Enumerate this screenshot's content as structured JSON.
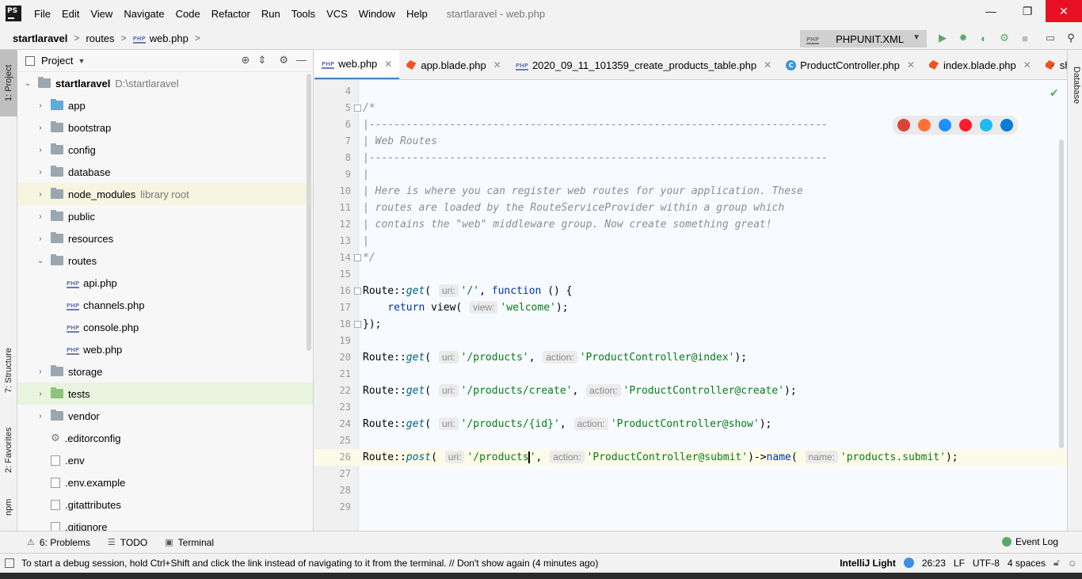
{
  "window": {
    "title": "startlaravel - web.php",
    "menu": [
      "File",
      "Edit",
      "View",
      "Navigate",
      "Code",
      "Refactor",
      "Run",
      "Tools",
      "VCS",
      "Window",
      "Help"
    ],
    "controls": {
      "minimize": "—",
      "maximize": "❐",
      "close": "✕"
    }
  },
  "breadcrumb": [
    "startlaravel",
    "routes",
    "web.php"
  ],
  "run_config": "PHPUNIT.XML",
  "left_tabs": [
    "1: Project",
    "7: Structure",
    "2: Favorites",
    "npm"
  ],
  "right_tabs": [
    "Database"
  ],
  "project": {
    "title": "Project",
    "root": {
      "name": "startlaravel",
      "path": "D:\\startlaravel"
    },
    "items": [
      {
        "name": "app",
        "type": "folder",
        "color": "blue",
        "depth": 1,
        "state": "collapsed"
      },
      {
        "name": "bootstrap",
        "type": "folder",
        "color": "gray",
        "depth": 1,
        "state": "collapsed"
      },
      {
        "name": "config",
        "type": "folder",
        "color": "gray",
        "depth": 1,
        "state": "collapsed"
      },
      {
        "name": "database",
        "type": "folder",
        "color": "gray",
        "depth": 1,
        "state": "collapsed"
      },
      {
        "name": "node_modules",
        "type": "folder",
        "color": "gray",
        "depth": 1,
        "state": "collapsed",
        "note": "library root",
        "highlight": "yellow"
      },
      {
        "name": "public",
        "type": "folder",
        "color": "gray",
        "depth": 1,
        "state": "collapsed"
      },
      {
        "name": "resources",
        "type": "folder",
        "color": "gray",
        "depth": 1,
        "state": "collapsed"
      },
      {
        "name": "routes",
        "type": "folder",
        "color": "gray",
        "depth": 1,
        "state": "expanded"
      },
      {
        "name": "api.php",
        "type": "php",
        "depth": 2
      },
      {
        "name": "channels.php",
        "type": "php",
        "depth": 2
      },
      {
        "name": "console.php",
        "type": "php",
        "depth": 2
      },
      {
        "name": "web.php",
        "type": "php",
        "depth": 2
      },
      {
        "name": "storage",
        "type": "folder",
        "color": "gray",
        "depth": 1,
        "state": "collapsed"
      },
      {
        "name": "tests",
        "type": "folder",
        "color": "green",
        "depth": 1,
        "state": "collapsed",
        "highlight": "green"
      },
      {
        "name": "vendor",
        "type": "folder",
        "color": "gray",
        "depth": 1,
        "state": "collapsed"
      },
      {
        "name": ".editorconfig",
        "type": "config",
        "depth": 1
      },
      {
        "name": ".env",
        "type": "file",
        "depth": 1
      },
      {
        "name": ".env.example",
        "type": "file",
        "depth": 1
      },
      {
        "name": ".gitattributes",
        "type": "file",
        "depth": 1
      },
      {
        "name": ".gitignore",
        "type": "file",
        "depth": 1
      }
    ]
  },
  "tabs": [
    {
      "label": "web.php",
      "icon": "php",
      "active": true
    },
    {
      "label": "app.blade.php",
      "icon": "blade"
    },
    {
      "label": "2020_09_11_101359_create_products_table.php",
      "icon": "php"
    },
    {
      "label": "ProductController.php",
      "icon": "class"
    },
    {
      "label": "index.blade.php",
      "icon": "blade"
    },
    {
      "label": "show.blade.ph",
      "icon": "blade"
    }
  ],
  "editor": {
    "lines": [
      {
        "n": "4"
      },
      {
        "n": "5",
        "fold": true,
        "tokens": [
          {
            "t": "/*",
            "c": "cm"
          }
        ]
      },
      {
        "n": "6",
        "tokens": [
          {
            "t": "|--------------------------------------------------------------------------",
            "c": "cm"
          }
        ]
      },
      {
        "n": "7",
        "tokens": [
          {
            "t": "| Web Routes",
            "c": "cm"
          }
        ]
      },
      {
        "n": "8",
        "tokens": [
          {
            "t": "|--------------------------------------------------------------------------",
            "c": "cm"
          }
        ]
      },
      {
        "n": "9",
        "tokens": [
          {
            "t": "|",
            "c": "cm"
          }
        ]
      },
      {
        "n": "10",
        "tokens": [
          {
            "t": "| Here is where you can register web routes for your application. These",
            "c": "cm"
          }
        ]
      },
      {
        "n": "11",
        "tokens": [
          {
            "t": "| routes are loaded by the RouteServiceProvider within a group which",
            "c": "cm"
          }
        ]
      },
      {
        "n": "12",
        "tokens": [
          {
            "t": "| contains the \"web\" middleware group. Now create something great!",
            "c": "cm"
          }
        ]
      },
      {
        "n": "13",
        "tokens": [
          {
            "t": "|",
            "c": "cm"
          }
        ]
      },
      {
        "n": "14",
        "fold": true,
        "tokens": [
          {
            "t": "*/",
            "c": "cm"
          }
        ]
      },
      {
        "n": "15"
      },
      {
        "n": "16",
        "fold": true,
        "tokens": [
          {
            "t": "Route::"
          },
          {
            "t": "get",
            "c": "fn"
          },
          {
            "t": "( "
          },
          {
            "h": "uri:"
          },
          {
            "t": "'/'",
            "c": "str"
          },
          {
            "t": ", "
          },
          {
            "t": "function",
            "c": "kw"
          },
          {
            "t": " () {"
          }
        ]
      },
      {
        "n": "17",
        "tokens": [
          {
            "t": "    "
          },
          {
            "t": "return",
            "c": "kw"
          },
          {
            "t": " view( "
          },
          {
            "h": "view:"
          },
          {
            "t": "'welcome'",
            "c": "str"
          },
          {
            "t": ");"
          }
        ]
      },
      {
        "n": "18",
        "fold": true,
        "tokens": [
          {
            "t": "});"
          }
        ]
      },
      {
        "n": "19"
      },
      {
        "n": "20",
        "tokens": [
          {
            "t": "Route::"
          },
          {
            "t": "get",
            "c": "fn"
          },
          {
            "t": "( "
          },
          {
            "h": "uri:"
          },
          {
            "t": "'/products'",
            "c": "str"
          },
          {
            "t": ", "
          },
          {
            "h": "action:"
          },
          {
            "t": "'ProductController@index'",
            "c": "str"
          },
          {
            "t": ");"
          }
        ]
      },
      {
        "n": "21"
      },
      {
        "n": "22",
        "tokens": [
          {
            "t": "Route::"
          },
          {
            "t": "get",
            "c": "fn"
          },
          {
            "t": "( "
          },
          {
            "h": "uri:"
          },
          {
            "t": "'/products/create'",
            "c": "str"
          },
          {
            "t": ", "
          },
          {
            "h": "action:"
          },
          {
            "t": "'ProductController@create'",
            "c": "str"
          },
          {
            "t": ");"
          }
        ]
      },
      {
        "n": "23"
      },
      {
        "n": "24",
        "tokens": [
          {
            "t": "Route::"
          },
          {
            "t": "get",
            "c": "fn"
          },
          {
            "t": "( "
          },
          {
            "h": "uri:"
          },
          {
            "t": "'/products/{id}'",
            "c": "str"
          },
          {
            "t": ", "
          },
          {
            "h": "action:"
          },
          {
            "t": "'ProductController@show'",
            "c": "str"
          },
          {
            "t": ");"
          }
        ]
      },
      {
        "n": "25"
      },
      {
        "n": "26",
        "current": true,
        "tokens": [
          {
            "t": "Route::"
          },
          {
            "t": "post",
            "c": "fn"
          },
          {
            "t": "( "
          },
          {
            "h": "uri:"
          },
          {
            "t": "'/products",
            "c": "str"
          },
          {
            "caret": true
          },
          {
            "t": "'",
            "c": "str"
          },
          {
            "t": ", "
          },
          {
            "h": "action:"
          },
          {
            "t": "'ProductController@submit'",
            "c": "str"
          },
          {
            "t": ")->"
          },
          {
            "t": "name",
            "c": "kw"
          },
          {
            "t": "( "
          },
          {
            "h": "name:"
          },
          {
            "t": "'products.submit'",
            "c": "str"
          },
          {
            "t": ");"
          }
        ]
      },
      {
        "n": "27"
      },
      {
        "n": "28"
      },
      {
        "n": "29"
      }
    ]
  },
  "browsers": [
    {
      "name": "chrome-icon",
      "color": "#db4437"
    },
    {
      "name": "firefox-icon",
      "color": "#ff7139"
    },
    {
      "name": "safari-icon",
      "color": "#1e90ff"
    },
    {
      "name": "opera-icon",
      "color": "#ff1b2d"
    },
    {
      "name": "ie-icon",
      "color": "#1ebbee"
    },
    {
      "name": "edge-icon",
      "color": "#0c7bd6"
    }
  ],
  "tool_windows": [
    {
      "icon": "⚠",
      "label": "6: Problems"
    },
    {
      "icon": "☰",
      "label": "TODO"
    },
    {
      "icon": "▣",
      "label": "Terminal"
    }
  ],
  "event_log": "Event Log",
  "status": {
    "message": "To start a debug session, hold Ctrl+Shift and click the link instead of navigating to it from the terminal. // Don't show again (4 minutes ago)",
    "theme": "IntelliJ Light",
    "position": "26:23",
    "line_sep": "LF",
    "encoding": "UTF-8",
    "indent": "4 spaces"
  },
  "colors": {
    "accent": "#4083c9",
    "close": "#e81123",
    "caret_line": "#fcfae8",
    "comment": "#8c8c8c",
    "string": "#067d17",
    "keyword": "#0033b3",
    "function": "#00627a"
  }
}
